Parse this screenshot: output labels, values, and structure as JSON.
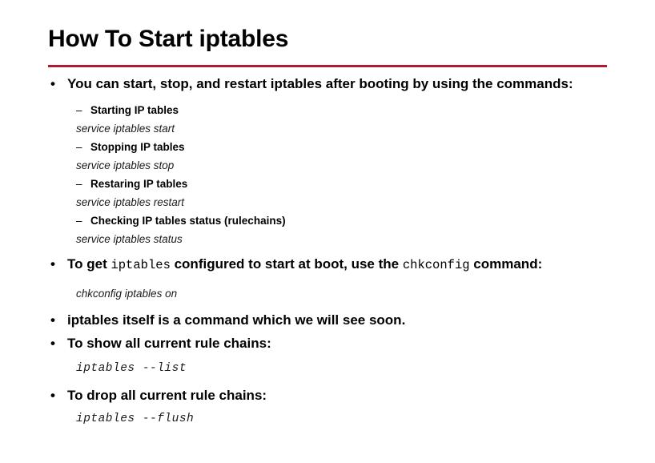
{
  "slide": {
    "title": "How To Start iptables",
    "rule_color": "#B01A32",
    "background_color": "#FFFFFF",
    "text_color": "#000000"
  },
  "bullets": {
    "intro": {
      "marker": "•",
      "text": "You can start, stop, and restart iptables after booting by using the commands:"
    },
    "sub_items": [
      {
        "marker": "–",
        "label": "Starting IP tables",
        "command": "service iptables start"
      },
      {
        "marker": "–",
        "label": "Stopping IP tables",
        "command": "service iptables stop"
      },
      {
        "marker": "–",
        "label": "Restaring IP tables",
        "command": "service iptables restart"
      },
      {
        "marker": "–",
        "label": "Checking IP tables status (rulechains)",
        "command": "service iptables status"
      }
    ],
    "chkconfig": {
      "marker": "•",
      "text_part1": "To get ",
      "code1": "iptables",
      "text_part2": " configured to start at boot, use the ",
      "code2": "chkconfig",
      "text_part3": " command:",
      "command": "chkconfig iptables on"
    },
    "itself": {
      "marker": "•",
      "text": "iptables itself is a command which we will see soon."
    },
    "show_chains": {
      "marker": "•",
      "text": "To show all current rule chains:",
      "command": "iptables --list"
    },
    "drop_chains": {
      "marker": "•",
      "text": "To drop all current rule chains:",
      "command": "iptables --flush"
    }
  }
}
